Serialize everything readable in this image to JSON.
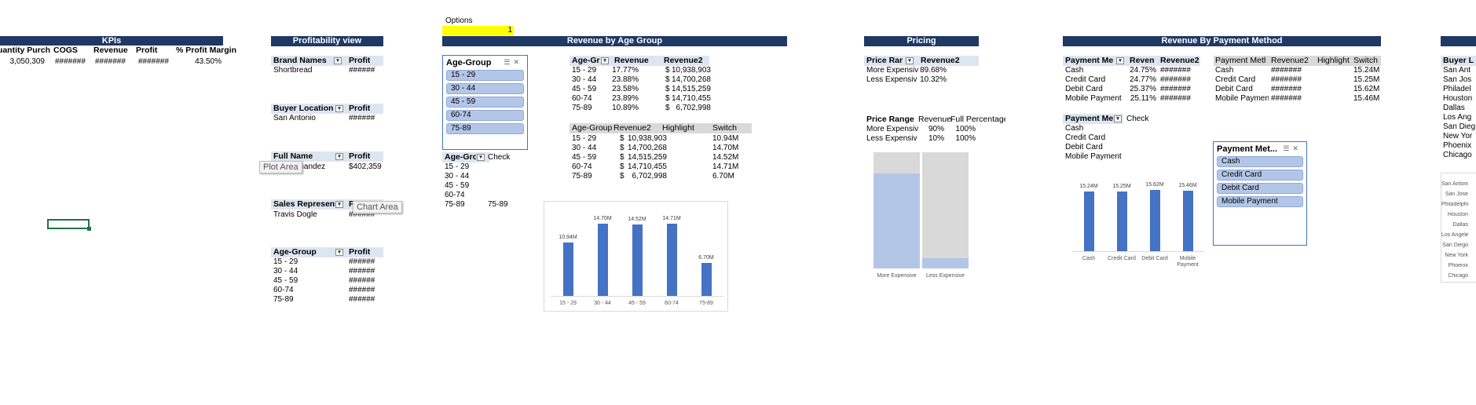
{
  "options": {
    "label": "Options",
    "value": "1"
  },
  "kpis": {
    "title": "KPIs",
    "headers": [
      "Quantity Purch",
      "COGS",
      "Revenue",
      "Profit",
      "% Profit Margin"
    ],
    "values": [
      "3,050,309",
      "#######",
      "#######",
      "#######",
      "43.50%"
    ]
  },
  "profitability": {
    "title": "Profitability view",
    "brand": {
      "h1": "Brand Names",
      "h2": "Profit",
      "rows": [
        [
          "Shortbread",
          "######"
        ]
      ]
    },
    "location": {
      "h1": "Buyer Location",
      "h2": "Profit",
      "rows": [
        [
          "San Antonio",
          "######"
        ]
      ]
    },
    "fullname": {
      "h1": "Full Name",
      "h2": "Profit",
      "rows": [
        [
          "rnandez",
          "$402,359"
        ]
      ]
    },
    "sales": {
      "h1": "Sales Represen",
      "h2": "P",
      "rows": [
        [
          "Travis Dogle",
          "######"
        ]
      ]
    },
    "age": {
      "h1": "Age-Group",
      "h2": "Profit",
      "rows": [
        [
          "15 - 29",
          "######"
        ],
        [
          "30 - 44",
          "######"
        ],
        [
          "45 - 59",
          "######"
        ],
        [
          "60-74",
          "######"
        ],
        [
          "75-89",
          "######"
        ]
      ]
    }
  },
  "tooltips": {
    "plot_area": "Plot Area",
    "chart_area": "Chart Area"
  },
  "revenue_age": {
    "title": "Revenue by Age Group",
    "slicer": {
      "title": "Age-Group",
      "items": [
        "15 - 29",
        "30 - 44",
        "45 - 59",
        "60-74",
        "75-89"
      ]
    },
    "pivot": {
      "headers": [
        "Age-Gr",
        "Revenue",
        "Revenue2"
      ],
      "rows": [
        [
          "15 - 29",
          "17.77%",
          "$",
          "10,938,903"
        ],
        [
          "30 - 44",
          "23.88%",
          "$",
          "14,700,268"
        ],
        [
          "45 - 59",
          "23.58%",
          "$",
          "14,515,259"
        ],
        [
          "60-74",
          "23.89%",
          "$",
          "14,710,455"
        ],
        [
          "75-89",
          "10.89%",
          "$",
          "6,702,998"
        ]
      ]
    },
    "table2": {
      "headers": [
        "Age-Group",
        "Revenue2",
        "Highlight",
        "Switch"
      ],
      "rows": [
        [
          "15 - 29",
          "$",
          "10,938,903",
          "10.94M"
        ],
        [
          "30 - 44",
          "$",
          "14,700,268",
          "14.70M"
        ],
        [
          "45 - 59",
          "$",
          "14,515,259",
          "14.52M"
        ],
        [
          "60-74",
          "$",
          "14,710,455",
          "14.71M"
        ],
        [
          "75-89",
          "$",
          "6,702,998",
          "6.70M"
        ]
      ]
    },
    "check": {
      "h1": "Age-Gro",
      "h2": "Check",
      "rows": [
        [
          "15 - 29",
          ""
        ],
        [
          "30 - 44",
          ""
        ],
        [
          "45 - 59",
          ""
        ],
        [
          "60-74",
          ""
        ],
        [
          "75-89",
          "75-89"
        ]
      ]
    }
  },
  "pricing": {
    "title": "Pricing",
    "pivot": {
      "headers": [
        "Price Rar",
        "Revenue2"
      ],
      "rows": [
        [
          "More Expensiv",
          "89.68%"
        ],
        [
          "Less Expensiv",
          "10.32%"
        ]
      ]
    },
    "table": {
      "headers": [
        "Price Range",
        "Revenue",
        "Full Percentage"
      ],
      "rows": [
        [
          "More Expensiv",
          "90%",
          "100%"
        ],
        [
          "Less Expensiv",
          "10%",
          "100%"
        ]
      ]
    }
  },
  "payment": {
    "title": "Revenue By Payment Method",
    "pivot": {
      "headers": [
        "Payment Me",
        "Reven",
        "Revenue2"
      ],
      "rows": [
        [
          "Cash",
          "24.75%",
          "#######"
        ],
        [
          "Credit Card",
          "24.77%",
          "#######"
        ],
        [
          "Debit Card",
          "25.37%",
          "#######"
        ],
        [
          "Mobile Payment",
          "25.11%",
          "#######"
        ]
      ]
    },
    "table": {
      "headers": [
        "Payment Metho",
        "Revenue2",
        "Highlight",
        "Switch"
      ],
      "rows": [
        [
          "Cash",
          "#######",
          "",
          "15.24M"
        ],
        [
          "Credit Card",
          "#######",
          "",
          "15.25M"
        ],
        [
          "Debit Card",
          "#######",
          "",
          "15.62M"
        ],
        [
          "Mobile Paymen",
          "#######",
          "",
          "15.46M"
        ]
      ]
    },
    "check": {
      "h1": "Payment Me",
      "h2": "Check",
      "rows": [
        "Cash",
        "Credit Card",
        "Debit Card",
        "Mobile Payment"
      ]
    },
    "slicer": {
      "title": "Payment Met...",
      "items": [
        "Cash",
        "Credit Card",
        "Debit Card",
        "Mobile Payment"
      ]
    }
  },
  "buyer": {
    "header": "Buyer L",
    "rows": [
      "San Ant",
      "San Jos",
      "Philadel",
      "Houston",
      "Dallas",
      "Los Ang",
      "San Dieg",
      "New Yor",
      "Phoenix",
      "Chicago"
    ],
    "chart_labels": [
      "San Antonio",
      "San Jose",
      "Philadelphia",
      "Houston",
      "Dallas",
      "Los Angeles",
      "San Diego",
      "New York",
      "Phoenix",
      "Chicago"
    ]
  },
  "chart_data": [
    {
      "type": "bar",
      "categories": [
        "15 - 29",
        "30 - 44",
        "45 - 59",
        "60-74",
        "75-89"
      ],
      "values": [
        10.94,
        14.7,
        14.52,
        14.71,
        6.7
      ],
      "data_labels": [
        "10.94M",
        "14.70M",
        "14.52M",
        "14.71M",
        "6.70M"
      ],
      "ylim": [
        0,
        16
      ]
    },
    {
      "type": "bar",
      "categories": [
        "More Expensive",
        "Less Expensive"
      ],
      "values": [
        90,
        10
      ],
      "full_values": [
        100,
        100
      ],
      "ylim": [
        0,
        100
      ]
    },
    {
      "type": "bar",
      "categories": [
        "Cash",
        "Credit Card",
        "Debit Card",
        "Mobile Payment"
      ],
      "values": [
        15.24,
        15.25,
        15.62,
        15.46
      ],
      "data_labels": [
        "15.24M",
        "15.25M",
        "15.62M",
        "15.46M"
      ],
      "ylim": [
        0,
        18
      ]
    }
  ]
}
